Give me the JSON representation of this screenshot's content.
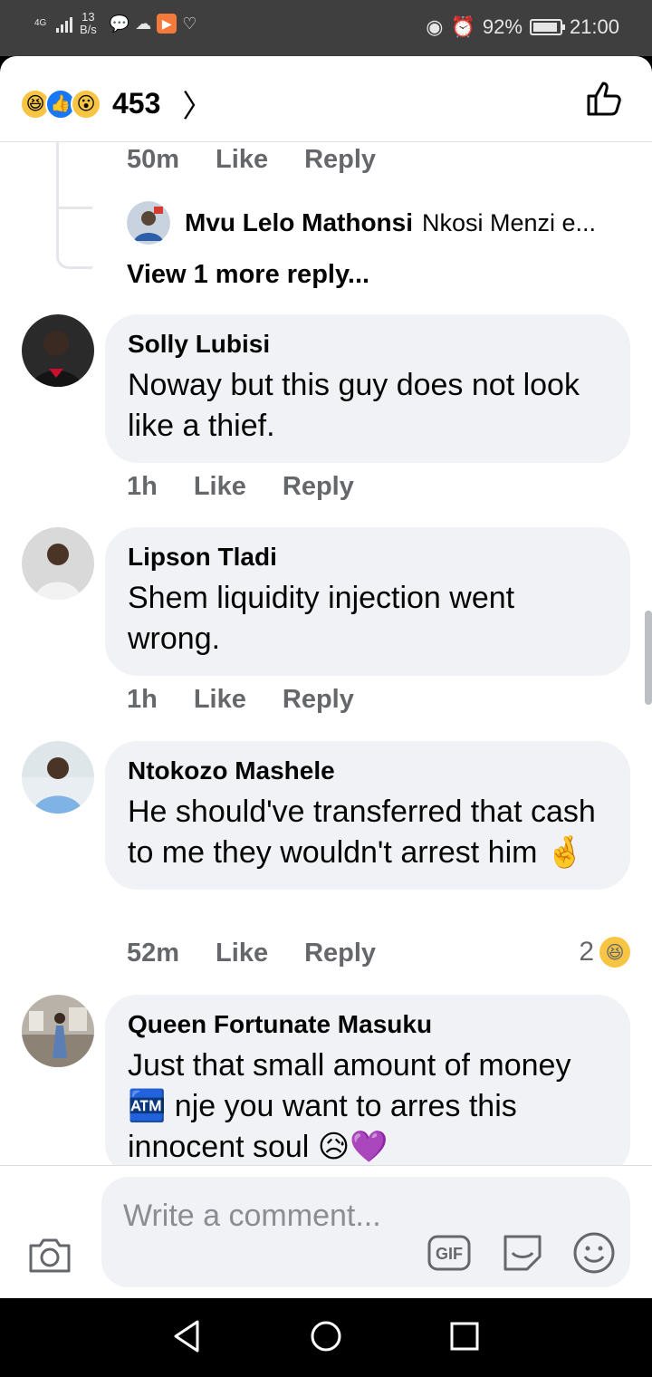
{
  "status_bar": {
    "network": "4G",
    "speed_value": "13",
    "speed_unit": "B/s",
    "battery": "92%",
    "battery_level": 0.92,
    "time": "21:00"
  },
  "header": {
    "reaction_count": "453",
    "reaction_icons": [
      "haha-icon",
      "like-icon",
      "wow-icon"
    ]
  },
  "prev_comment_meta": {
    "time": "50m",
    "like": "Like",
    "reply": "Reply"
  },
  "nested_reply": {
    "name": "Mvu Lelo Mathonsi",
    "text": "Nkosi Menzi e...",
    "view_more": "View 1 more reply..."
  },
  "comments": [
    {
      "name": "Solly Lubisi",
      "text": "Noway but this guy does not look like a thief.",
      "time": "1h",
      "like": "Like",
      "reply": "Reply"
    },
    {
      "name": "Lipson Tladi",
      "text": "Shem liquidity injection went wrong.",
      "time": "1h",
      "like": "Like",
      "reply": "Reply"
    },
    {
      "name": "Ntokozo Mashele",
      "text": "He should've transferred that cash to me they wouldn't arrest him 🤞",
      "time": "52m",
      "like": "Like",
      "reply": "Reply",
      "reaction_count": "2"
    },
    {
      "name": "Queen Fortunate Masuku",
      "text": "Just that small amount of money 🏧 nje you want to arres this innocent soul 😥💜"
    }
  ],
  "composer": {
    "placeholder": "Write a comment...",
    "gif_label": "GIF"
  },
  "colors": {
    "accent": "#1877f2",
    "bubble": "#f0f2f5",
    "meta_text": "#65676b"
  }
}
